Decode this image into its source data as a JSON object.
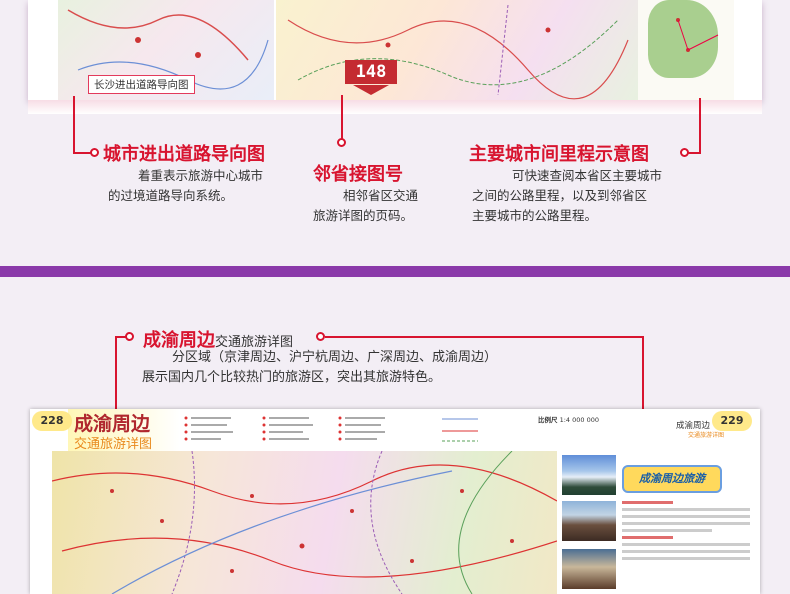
{
  "top_map": {
    "inset_label": "长沙进出道路导向图",
    "page_number": "148"
  },
  "callouts": [
    {
      "title": "城市进出道路导向图",
      "desc_line1": "着重表示旅游中心城市",
      "desc_line2": "的过境道路导向系统。"
    },
    {
      "title": "邻省接图号",
      "desc_line1": "相邻省区交通",
      "desc_line2": "旅游详图的页码。"
    },
    {
      "title": "主要城市间里程示意图",
      "desc_line1": "可快速查阅本省区主要城市",
      "desc_line2": "之间的公路里程，以及到邻省区",
      "desc_line3": "主要城市的公路里程。"
    }
  ],
  "section2": {
    "title_big": "成渝周边",
    "title_small": "交通旅游详图",
    "desc_line1": "分区域（京津周边、沪宁杭周边、广深周边、成渝周边）",
    "desc_line2": "展示国内几个比较热门的旅游区，突出其旅游特色。"
  },
  "bottom_map": {
    "page_left": "228",
    "page_right": "229",
    "title": "成渝周边",
    "subtitle": "交通旅游详图",
    "scale_label": "比例尺",
    "scale_value": "1:4 000 000",
    "right_title": "成渝周边",
    "right_subtitle": "交通旅游详图",
    "banner": "成渝周边旅游"
  },
  "colors": {
    "accent_red": "#d8142f",
    "divider_purple": "#8a39a9",
    "page_badge": "#c42b31"
  }
}
